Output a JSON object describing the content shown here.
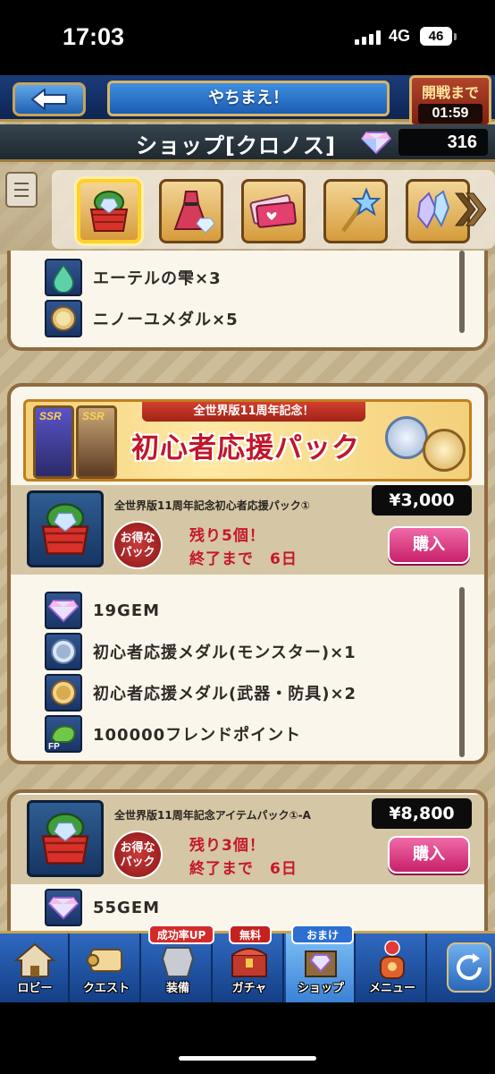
{
  "status_bar": {
    "time": "17:03",
    "network": "4G",
    "battery": "46"
  },
  "header": {
    "back_label": "",
    "title": "やちまえ！",
    "timer_label": "開戦まで",
    "timer_value": "01:59"
  },
  "shop": {
    "title": "ショップ[クロノス]",
    "gem_count": "316"
  },
  "categories": [
    {
      "name": "gift-box",
      "selected": true
    },
    {
      "name": "dress",
      "selected": false
    },
    {
      "name": "tickets",
      "selected": false
    },
    {
      "name": "wand",
      "selected": false
    },
    {
      "name": "crystal",
      "selected": false
    }
  ],
  "panel1": {
    "items": [
      "エーテルの雫×3",
      "ニノーユメダル×5"
    ]
  },
  "panel2": {
    "banner_ribbon": "全世界版11周年記念！",
    "banner_title": "初心者応援パック",
    "ssr_label": "SSR",
    "pack_name": "全世界版11周年記念初心者応援パック①",
    "price": "¥3,000",
    "badge": [
      "お得な",
      "パック"
    ],
    "remaining": "残り5個！",
    "deadline": "終了まで　6日",
    "buy_label": "購入",
    "items": [
      "19GEM",
      "初心者応援メダル(モンスター)×1",
      "初心者応援メダル(武器・防具)×2",
      "100000フレンドポイント"
    ],
    "fp_tag": "FP"
  },
  "panel3": {
    "pack_name": "全世界版11周年記念アイテムパック①-A",
    "price": "¥8,800",
    "badge": [
      "お得な",
      "パック"
    ],
    "remaining": "残り3個！",
    "deadline": "終了まで　6日",
    "buy_label": "購入",
    "items": [
      "55GEM"
    ]
  },
  "nav": {
    "items": [
      "ロビー",
      "クエスト",
      "装備",
      "ガチャ",
      "ショップ",
      "メニュー"
    ],
    "badge_success": "成功率UP",
    "badge_free": "無料",
    "badge_bonus": "おまけ"
  },
  "colors": {
    "accent_pink": "#c8206a",
    "price_bg": "#0c0c0c",
    "nav_blue": "#2f69c0",
    "frame_gold": "#b89447"
  }
}
